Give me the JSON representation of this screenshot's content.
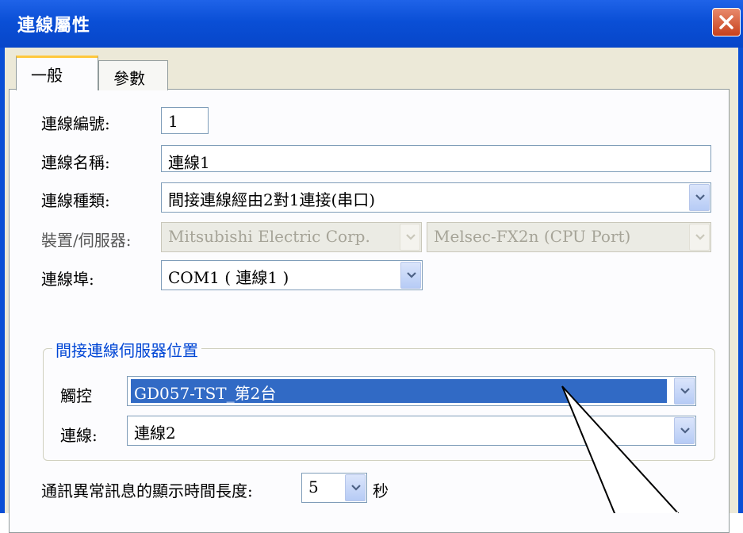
{
  "window": {
    "title": "連線屬性",
    "accent": "#0a4fd6"
  },
  "tabs": [
    {
      "label": "一般",
      "active": true
    },
    {
      "label": "參數",
      "active": false
    }
  ],
  "form": {
    "link_number_label": "連線編號:",
    "link_number_value": "1",
    "link_name_label": "連線名稱:",
    "link_name_value": "連線1",
    "link_type_label": "連線種類:",
    "link_type_value": "間接連線經由2對1連接(串口)",
    "device_label": "裝置/伺服器:",
    "device_vendor_value": "Mitsubishi Electric Corp.",
    "device_model_value": "Melsec-FX2n (CPU Port)",
    "port_label": "連線埠:",
    "port_value": "COM1 ( 連線1 )"
  },
  "server_group": {
    "legend": "間接連線伺服器位置",
    "touch_label": "觸控",
    "touch_value": "GD057-TST_第2台",
    "link_label": "連線:",
    "link_value": "連線2"
  },
  "timeout": {
    "label": "通訊異常訊息的顯示時間長度:",
    "value": "5",
    "unit": "秒"
  },
  "icons": {
    "close": "close-icon",
    "dropdown": "chevron-down-icon"
  }
}
